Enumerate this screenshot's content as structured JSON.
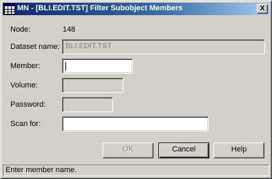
{
  "window": {
    "title": "MN - [BLI.EDIT.TST] Filter Subobject Members",
    "close_glyph": "X"
  },
  "form": {
    "node_label": "Node:",
    "node_value": "148",
    "dataset_label": "Dataset name:",
    "dataset_value": "BLI.EDIT.TST",
    "member_label": "Member:",
    "member_value": "",
    "volume_label": "Volume:",
    "volume_value": "",
    "password_label": "Password:",
    "password_value": "",
    "scan_label": "Scan for:",
    "scan_value": ""
  },
  "buttons": {
    "ok": "OK",
    "cancel": "Cancel",
    "help": "Help"
  },
  "status": {
    "text": "Enter member name."
  },
  "icons": {
    "window_icon": "grid-window-icon",
    "close": "close-icon"
  },
  "colors": {
    "titlebar_start": "#0a246a",
    "titlebar_end": "#a6caf0",
    "face": "#d4d0c8"
  }
}
